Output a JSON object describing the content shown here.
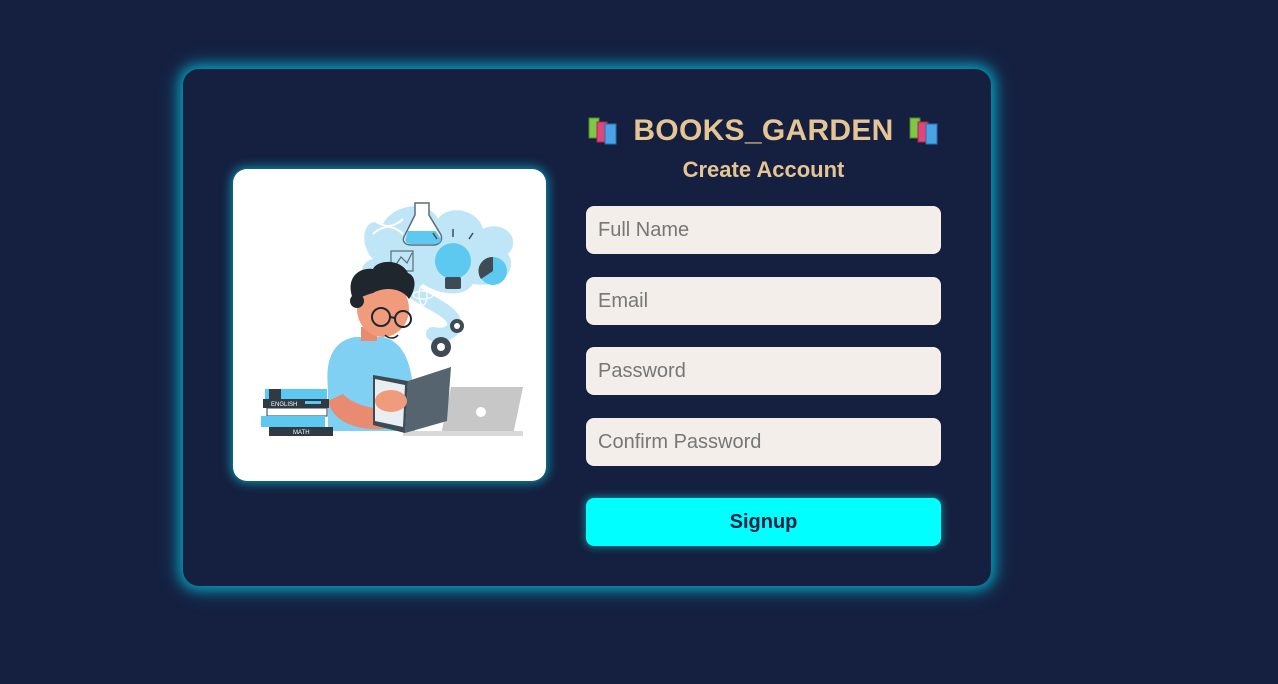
{
  "brand": {
    "name": "BOOKS_GARDEN",
    "left_icon": "books-stack-icon",
    "right_icon": "books-stack-icon"
  },
  "form": {
    "heading": "Create Account",
    "fields": [
      {
        "name": "full_name",
        "placeholder": "Full Name",
        "value": ""
      },
      {
        "name": "email",
        "placeholder": "Email",
        "value": ""
      },
      {
        "name": "password",
        "placeholder": "Password",
        "value": ""
      },
      {
        "name": "confirm_password",
        "placeholder": "Confirm Password",
        "value": ""
      }
    ],
    "submit_label": "Signup"
  },
  "illustration": {
    "subject": "student-reading-illustration",
    "book_labels": [
      "ENGLISH",
      "MATH"
    ]
  },
  "colors": {
    "background": "#152040",
    "card_glow": "#00e6ff",
    "brand_text": "#e6c594",
    "input_bg": "#f3eee9",
    "button_bg": "#00ffff"
  }
}
